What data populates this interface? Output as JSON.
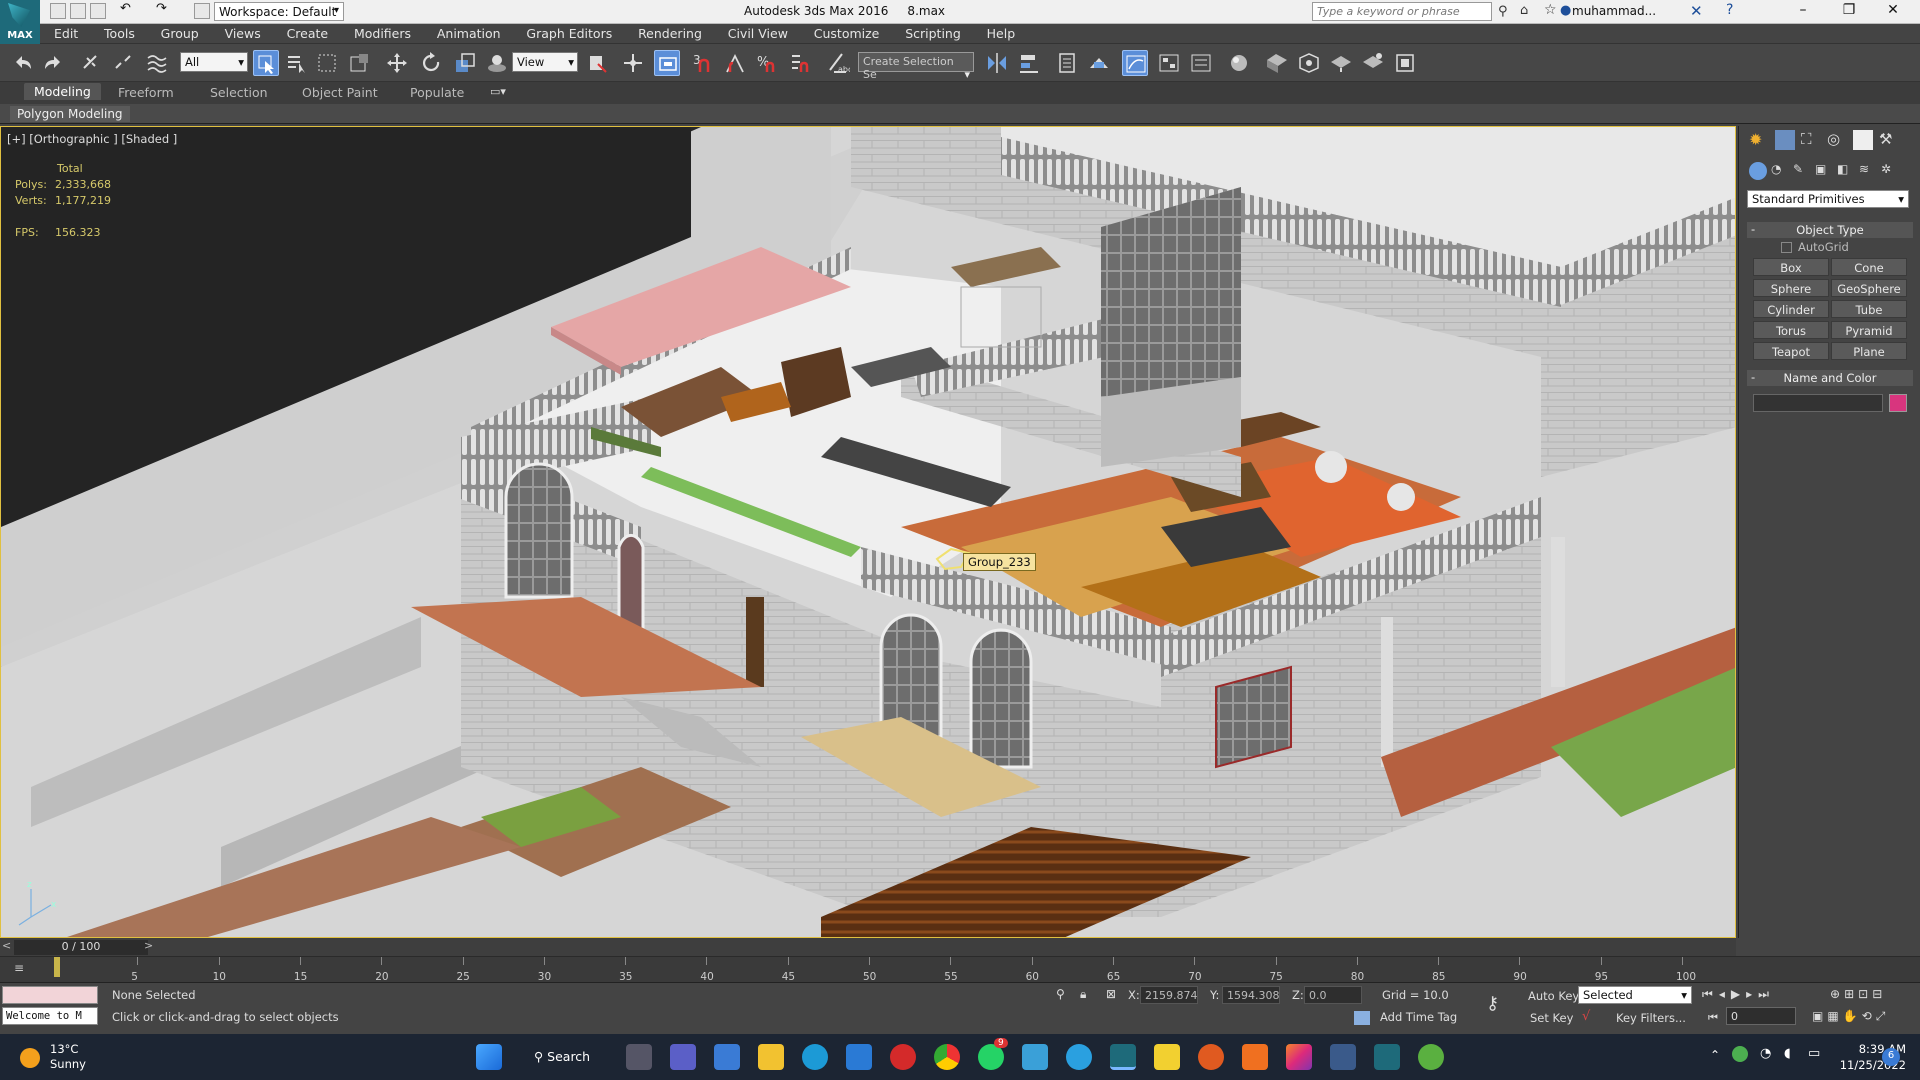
{
  "titlebar": {
    "logo_text": "MAX",
    "workspace": "Workspace: Default",
    "app_title": "Autodesk 3ds Max 2016     8.max",
    "search_placeholder": "Type a keyword or phrase",
    "user": "muhammad...",
    "brand_color": "#1e6a7a"
  },
  "menu": [
    "Edit",
    "Tools",
    "Group",
    "Views",
    "Create",
    "Modifiers",
    "Animation",
    "Graph Editors",
    "Rendering",
    "Civil View",
    "Customize",
    "Scripting",
    "Help"
  ],
  "toolbar": {
    "filter_value": "All",
    "refcoord_value": "View",
    "named_selection_placeholder": "Create Selection Se",
    "snap_label": "3",
    "accent_color": "#5b8ed8"
  },
  "ribbon": {
    "tabs": [
      "Modeling",
      "Freeform",
      "Selection",
      "Object Paint",
      "Populate"
    ],
    "active_tab": "Modeling",
    "panel": "Polygon Modeling"
  },
  "viewport": {
    "label": "[+] [Orthographic ] [Shaded ]",
    "stats": {
      "total_label": "Total",
      "polys_label": "Polys:",
      "polys": "2,333,668",
      "verts_label": "Verts:",
      "verts": "1,177,219",
      "fps_label": "FPS:",
      "fps": "156.323"
    },
    "tooltip": "Group_233"
  },
  "command_panel": {
    "dropdown": "Standard Primitives",
    "rollout_object_type": "Object Type",
    "autogrid": "AutoGrid",
    "buttons": [
      "Box",
      "Cone",
      "Sphere",
      "GeoSphere",
      "Cylinder",
      "Tube",
      "Torus",
      "Pyramid",
      "Teapot",
      "Plane"
    ],
    "rollout_name_color": "Name and Color",
    "object_color": "#d8357e"
  },
  "timeline": {
    "time_slider": "0 / 100",
    "ticks": [
      "5",
      "10",
      "15",
      "20",
      "25",
      "30",
      "35",
      "40",
      "45",
      "50",
      "55",
      "60",
      "65",
      "70",
      "75",
      "80",
      "85",
      "90",
      "95",
      "100"
    ]
  },
  "status": {
    "welcome": "Welcome to M",
    "selection": "None Selected",
    "hint": "Click or click-and-drag to select objects",
    "x_label": "X:",
    "x": "2159.874",
    "y_label": "Y:",
    "y": "1594.308",
    "z_label": "Z:",
    "z": "0.0",
    "grid": "Grid = 10.0",
    "add_time_tag": "Add Time Tag",
    "auto_key": "Auto Key",
    "set_key": "Set Key",
    "selected": "Selected",
    "key_filters": "Key Filters...",
    "frame": "0"
  },
  "taskbar": {
    "temp": "13°C",
    "weather": "Sunny",
    "search": "Search",
    "whatsapp_badge": "9",
    "time": "8:39 AM",
    "date": "11/25/2022",
    "notif_badge": "6"
  }
}
